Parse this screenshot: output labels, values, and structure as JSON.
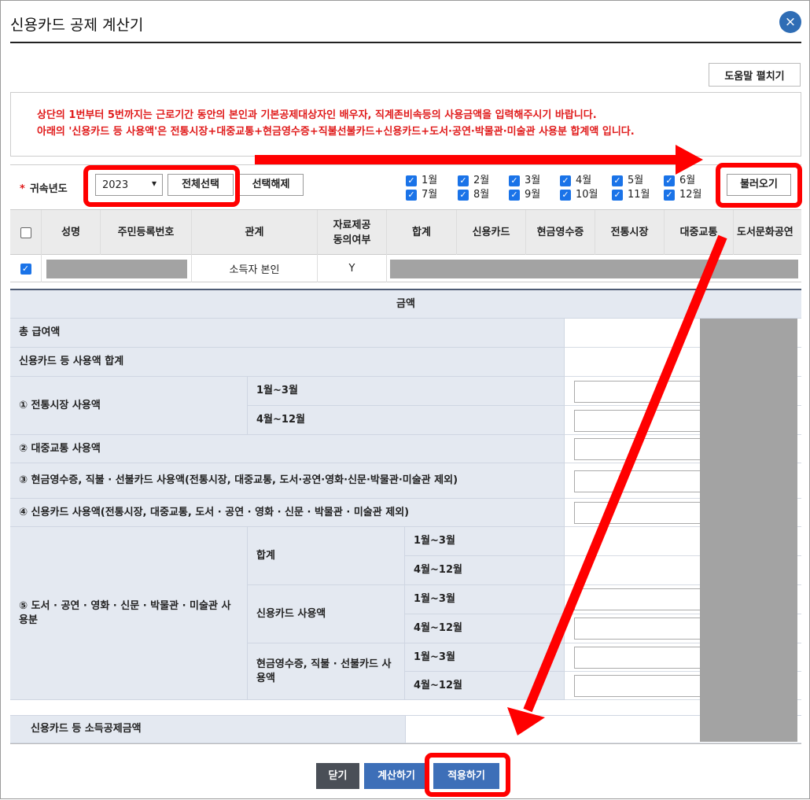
{
  "dialog": {
    "title": "신용카드 공제 계산기",
    "close_icon": "×",
    "help_button": "도움말 펼치기"
  },
  "notice": {
    "line1": "상단의 1번부터 5번까지는 근로기간 동안의 본인과 기본공제대상자인 배우자, 직계존비속등의 사용금액을 입력해주시기 바랍니다.",
    "line2": "아래의 '신용카드 등 사용액'은 전통시장+대중교통+현금영수증+직불선불카드+신용카드+도서·공연·박물관·미술관 사용분 합계액 입니다."
  },
  "controls": {
    "year_label_star": "*",
    "year_label": "귀속년도",
    "year_value": "2023",
    "select_all": "전체선택",
    "deselect_all": "선택해제",
    "load": "불러오기",
    "months_row1": [
      "1월",
      "2월",
      "3월",
      "4월",
      "5월",
      "6월"
    ],
    "months_row2": [
      "7월",
      "8월",
      "9월",
      "10월",
      "11월",
      "12월"
    ]
  },
  "grid": {
    "headers": [
      "성명",
      "주민등록번호",
      "관계",
      "자료제공\n동의여부",
      "합계",
      "신용카드",
      "현금영수증",
      "전통시장",
      "대중교통",
      "도서문화공연"
    ],
    "row": {
      "relation": "소득자 본인",
      "consent": "Y"
    }
  },
  "amount_table": {
    "header": "금액",
    "total_salary": "총 급여액",
    "card_total": "신용카드 등 사용액 합계",
    "item1": "① 전통시장 사용액",
    "item2": "② 대중교통 사용액",
    "item3": "③ 현금영수증, 직불 · 선불카드 사용액(전통시장, 대중교통, 도서·공연·영화·신문·박물관·미술관 제외)",
    "item4": "④ 신용카드 사용액(전통시장, 대중교통, 도서 · 공연 · 영화 · 신문 · 박물관 · 미술관 제외)",
    "item5": "⑤ 도서 · 공연 · 영화 · 신문 · 박물관 · 미술관 사용분",
    "period_a": "1월~3월",
    "period_b": "4월~12월",
    "sub_total": "합계",
    "sub_card": "신용카드 사용액",
    "sub_cash": "현금영수증, 직불 · 선불카드 사용액",
    "deduction": "신용카드 등 소득공제금액"
  },
  "footer": {
    "close": "닫기",
    "calculate": "계산하기",
    "apply": "적용하기"
  },
  "colors": {
    "annotation_red": "#ff0000",
    "notice_red": "#e01b1b",
    "header_band": "#e4e9f1",
    "close_btn": "#2f6db5",
    "dark_btn": "#4a4f57",
    "blue_btn": "#3d6fb8"
  }
}
